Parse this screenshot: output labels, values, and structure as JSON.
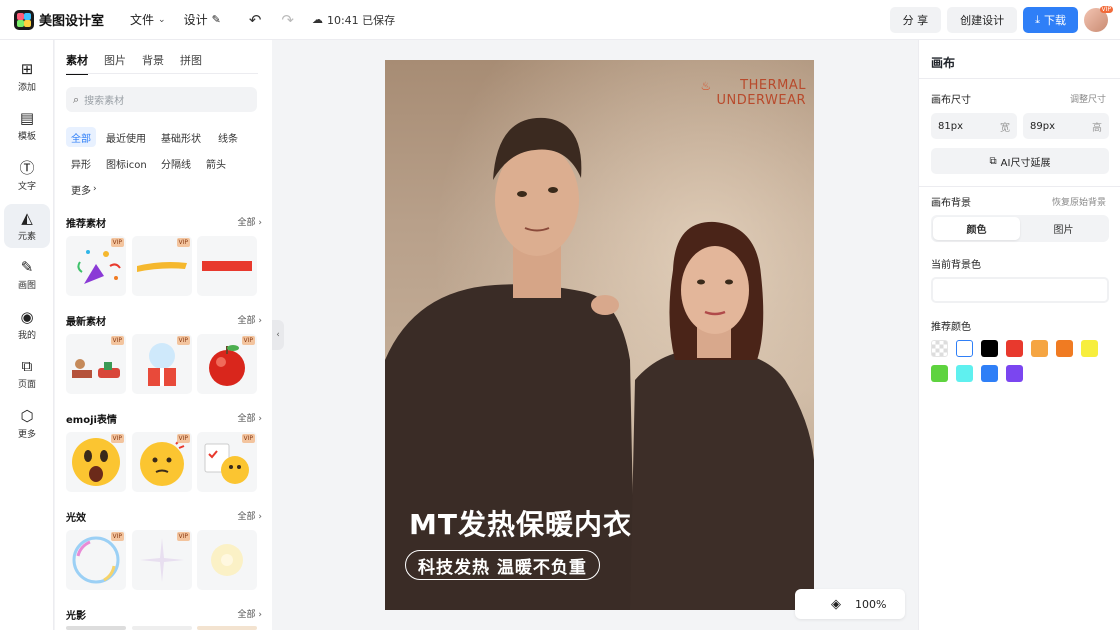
{
  "app": {
    "name": "美图设计室"
  },
  "toolbar": {
    "file_label": "文件",
    "design_label": "设计",
    "save_status": "10:41 已保存",
    "share_label": "分 享",
    "create_label": "创建设计",
    "download_label": "下载",
    "avatar_badge": "VIP"
  },
  "nav": {
    "items": [
      {
        "label": "添加",
        "icon": "plus-square-icon"
      },
      {
        "label": "模板",
        "icon": "template-icon"
      },
      {
        "label": "文字",
        "icon": "text-icon"
      },
      {
        "label": "元素",
        "icon": "shapes-icon"
      },
      {
        "label": "画图",
        "icon": "draw-icon"
      },
      {
        "label": "我的",
        "icon": "user-icon"
      },
      {
        "label": "页面",
        "icon": "add-page-icon"
      },
      {
        "label": "更多",
        "icon": "cube-icon"
      }
    ],
    "active_index": 3
  },
  "panel": {
    "tabs": [
      "素材",
      "图片",
      "背景",
      "拼图"
    ],
    "search_placeholder": "搜索素材",
    "chips": [
      "全部",
      "最近使用",
      "基础形状",
      "线条",
      "异形",
      "图标icon",
      "分隔线",
      "箭头",
      "更多"
    ],
    "sections": [
      {
        "title": "推荐素材",
        "all": "全部"
      },
      {
        "title": "最新素材",
        "all": "全部"
      },
      {
        "title": "emoji表情",
        "all": "全部"
      },
      {
        "title": "光效",
        "all": "全部"
      },
      {
        "title": "光影",
        "all": "全部"
      }
    ],
    "vip_badge": "VIP"
  },
  "canvas": {
    "brand_line1": "THERMAL",
    "brand_line2": "UNDERWEAR",
    "headline": "MT发热保暖内衣",
    "subline": "科技发热 温暖不负重",
    "zoom": "100%"
  },
  "right_panel": {
    "title": "画布",
    "size_label": "画布尺寸",
    "resize_link": "调整尺寸",
    "width_value": "81px",
    "width_unit": "宽",
    "height_value": "89px",
    "height_unit": "高",
    "ai_extend_label": "AI尺寸延展",
    "bg_label": "画布背景",
    "restore_link": "恢复原始背景",
    "seg_color": "颜色",
    "seg_image": "图片",
    "current_bg_label": "当前背景色",
    "recommended_label": "推荐颜色",
    "swatches": [
      "transparent",
      "#ffffff",
      "#000000",
      "#e8392d",
      "#f5a542",
      "#f07b22",
      "#f7ee3d",
      "#5ed33f",
      "#5ff0ef",
      "#2f7ff7",
      "#7b46f0"
    ]
  }
}
